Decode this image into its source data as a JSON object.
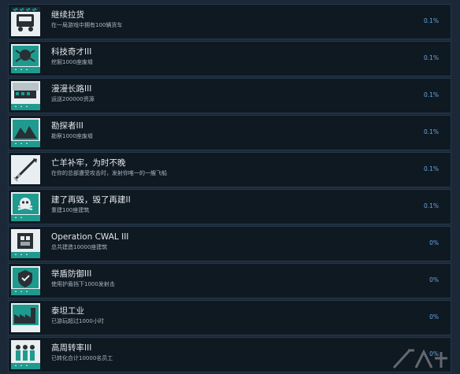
{
  "achievements": [
    {
      "title": "继续拉货",
      "desc": "在一局游戏中拥有100辆货车",
      "pct": "0.1%",
      "icon": "truck-icon"
    },
    {
      "title": "科技奇才III",
      "desc": "挖掘1000座废墟",
      "pct": "0.1%",
      "icon": "tech-ruins-icon"
    },
    {
      "title": "漫漫长路III",
      "desc": "运送200000资源",
      "pct": "0.1%",
      "icon": "train-icon"
    },
    {
      "title": "勘探者III",
      "desc": "勘察1000座废墟",
      "pct": "0.1%",
      "icon": "explorer-icon"
    },
    {
      "title": "亡羊补牢，为时不晚",
      "desc": "在你的总部遭受攻击时，发射你唯一的一艘飞船",
      "pct": "0.1%",
      "icon": "rocket-icon"
    },
    {
      "title": "建了再毁，毁了再建II",
      "desc": "重建100座建筑",
      "pct": "0.1%",
      "icon": "skull-icon"
    },
    {
      "title": "Operation CWAL III",
      "desc": "总共建造10000座建筑",
      "pct": "0%",
      "icon": "construction-icon"
    },
    {
      "title": "举盾防御III",
      "desc": "使用护盾挡下1000发射击",
      "pct": "0%",
      "icon": "shield-icon"
    },
    {
      "title": "泰坦工业",
      "desc": "已游玩超过1000小时",
      "pct": "0%",
      "icon": "factory-icon"
    },
    {
      "title": "高周转率III",
      "desc": "已转化合计10000名员工",
      "pct": "0%",
      "icon": "workers-icon"
    }
  ],
  "colors": {
    "background": "#1b2838",
    "row": "#0f1922",
    "icon_teal": "#1f9a8f",
    "percent": "#6aa8de"
  }
}
